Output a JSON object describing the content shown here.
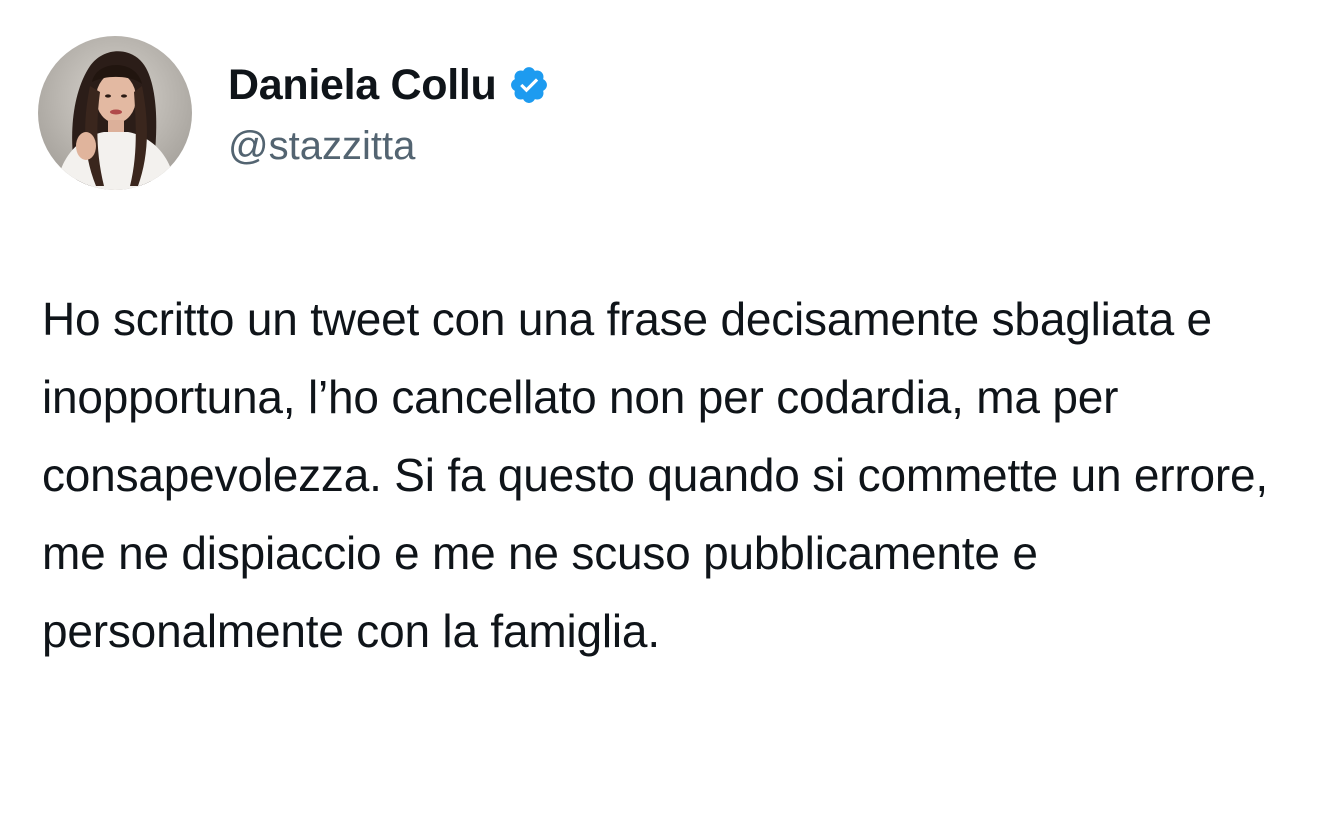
{
  "author": {
    "display_name": "Daniela Collu",
    "handle": "@stazzitta",
    "verified": true,
    "verified_icon": "verified-badge-icon",
    "avatar_icon": "profile-avatar",
    "accent_color": "#1d9bf0"
  },
  "tweet": {
    "text": "Ho scritto un tweet con una frase decisamente sbagliata e inopportuna, l’ho cancellato non per codardia, ma per consapevolezza. Si fa questo quando si commette un errore, me ne dispiaccio e me ne scuso pubblicamente e personalmente con la famiglia."
  },
  "colors": {
    "background": "#ffffff",
    "text_primary": "#0f1419",
    "text_secondary": "#536471"
  }
}
